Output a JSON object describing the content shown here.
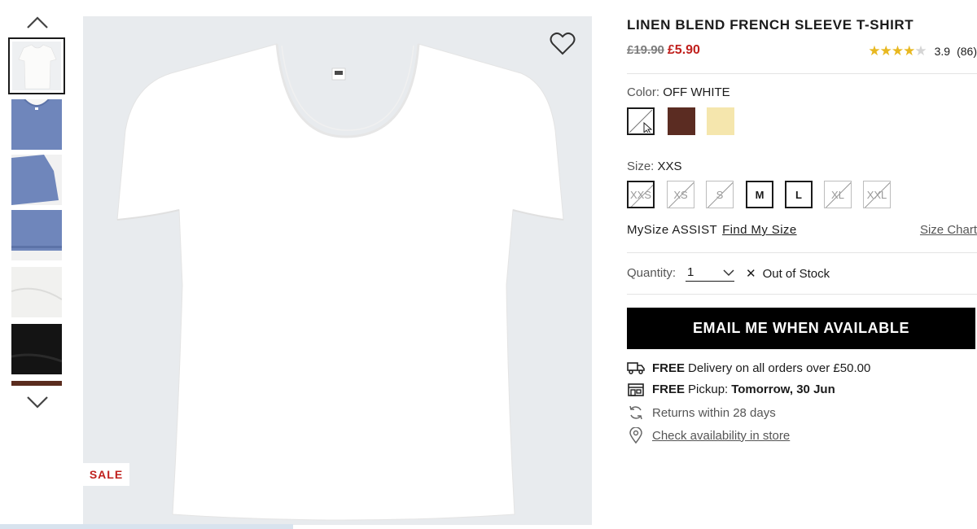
{
  "thumbnail_rail": {
    "up_icon": "chevron-up-icon",
    "down_icon": "chevron-down-icon",
    "thumbnails": [
      {
        "color": "#f4f4f2",
        "kind": "white-shirt"
      },
      {
        "color": "#6f86bb",
        "kind": "blue-shirt-front"
      },
      {
        "color": "#6f86bb",
        "kind": "blue-sleeve"
      },
      {
        "color": "#6f86bb",
        "kind": "blue-hem"
      },
      {
        "color": "#f1f1ef",
        "kind": "white-fabric"
      },
      {
        "color": "#141414",
        "kind": "black-fabric"
      },
      {
        "color": "#5a2c1e",
        "kind": "brown-fabric"
      }
    ]
  },
  "main_image": {
    "background": "#e8ebee",
    "shirt_color": "#ffffff",
    "sale_badge": "SALE",
    "favorite_icon": "heart-icon"
  },
  "product": {
    "title": "LINEN BLEND FRENCH SLEEVE T-SHIRT",
    "old_price": "£19.90",
    "new_price": "£5.90",
    "rating_value": 4,
    "rating_max": 5,
    "rating_text": "3.9",
    "review_count": "(86)"
  },
  "color": {
    "label": "Color:",
    "selected": "OFF WHITE",
    "swatches": [
      {
        "name": "off-white",
        "color": "#ffffff"
      },
      {
        "name": "brown",
        "color": "#5b2c22"
      },
      {
        "name": "cream",
        "color": "#f5e6ad"
      }
    ]
  },
  "size": {
    "label": "Size:",
    "selected": "XXS",
    "options": [
      "XXS",
      "XS",
      "S",
      "M",
      "L",
      "XL",
      "XXL"
    ],
    "available": [
      "M",
      "L"
    ]
  },
  "mysize": {
    "label": "MySize ASSIST",
    "link": "Find My Size",
    "size_chart": "Size Chart"
  },
  "quantity": {
    "label": "Quantity:",
    "value": "1",
    "stock_status": "Out of Stock"
  },
  "cta": {
    "email_label": "EMAIL ME WHEN AVAILABLE"
  },
  "delivery": {
    "free1": "FREE",
    "delivery_text": "Delivery on all orders over £50.00",
    "free2": "FREE",
    "pickup_text": "Pickup:",
    "pickup_date": "Tomorrow, 30 Jun",
    "returns_text": "Returns within 28 days",
    "store_link": "Check availability in store"
  },
  "colors": {
    "sale_red": "#c0201d",
    "star_gold": "#e8b820",
    "button_black": "#000000"
  }
}
